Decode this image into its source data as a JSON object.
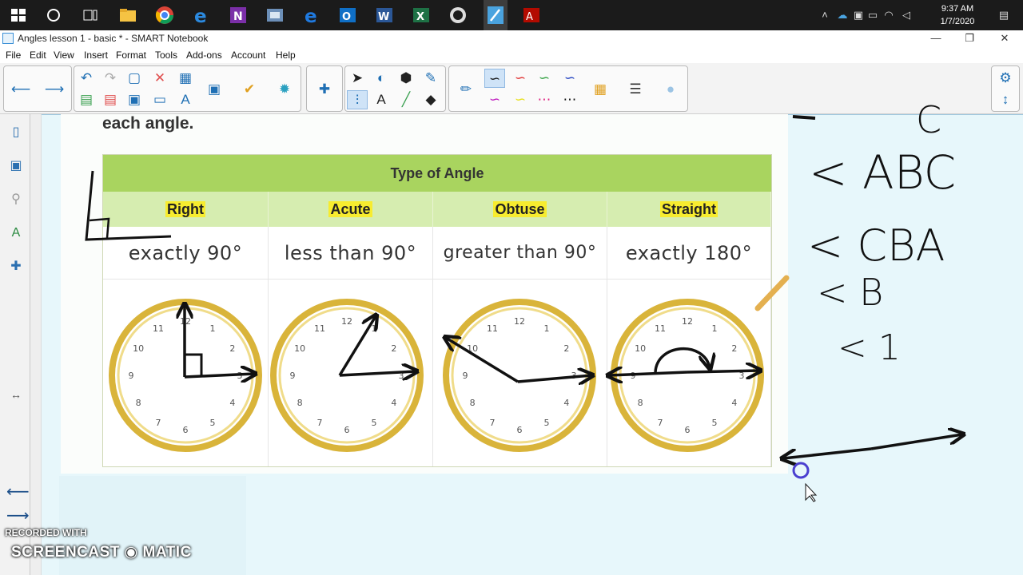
{
  "taskbar": {
    "time": "9:37 AM",
    "date": "1/7/2020",
    "apps": [
      "start-icon",
      "search-icon",
      "task-view-icon",
      "file-explorer-icon",
      "chrome-icon",
      "ie-icon",
      "onenote-icon",
      "media-icon",
      "edge-icon",
      "outlook-icon",
      "word-icon",
      "excel-icon",
      "obs-icon",
      "smart-notebook-icon",
      "acrobat-icon"
    ]
  },
  "window": {
    "title": "Angles lesson 1 - basic * - SMART Notebook"
  },
  "menu": [
    "File",
    "Edit",
    "View",
    "Insert",
    "Format",
    "Tools",
    "Add-ons",
    "Account",
    "Help"
  ],
  "worksheet": {
    "heading": "each angle.",
    "table_title": "Type of Angle",
    "columns": [
      {
        "name": "Right",
        "description": "exactly 90°"
      },
      {
        "name": "Acute",
        "description": "less than 90°"
      },
      {
        "name": "Obtuse",
        "description": "greater than 90°"
      },
      {
        "name": "Straight",
        "description": "exactly 180°"
      }
    ]
  },
  "annotations": {
    "line1": "< ABC",
    "line2": "< CBA",
    "line3": "< B",
    "line4": "< 1",
    "top_fragment": "C"
  },
  "watermark": {
    "recorded": "RECORDED WITH",
    "brand": "SCREENCAST ◉ MATIC"
  },
  "colors": {
    "taskbar": "#1b1b1b",
    "canvas": "#e7f7fb",
    "table_header": "#a9d45f",
    "column_header": "#d6edb0",
    "highlight": "#f7ec2f",
    "clock_rim": "#d9b43a"
  }
}
